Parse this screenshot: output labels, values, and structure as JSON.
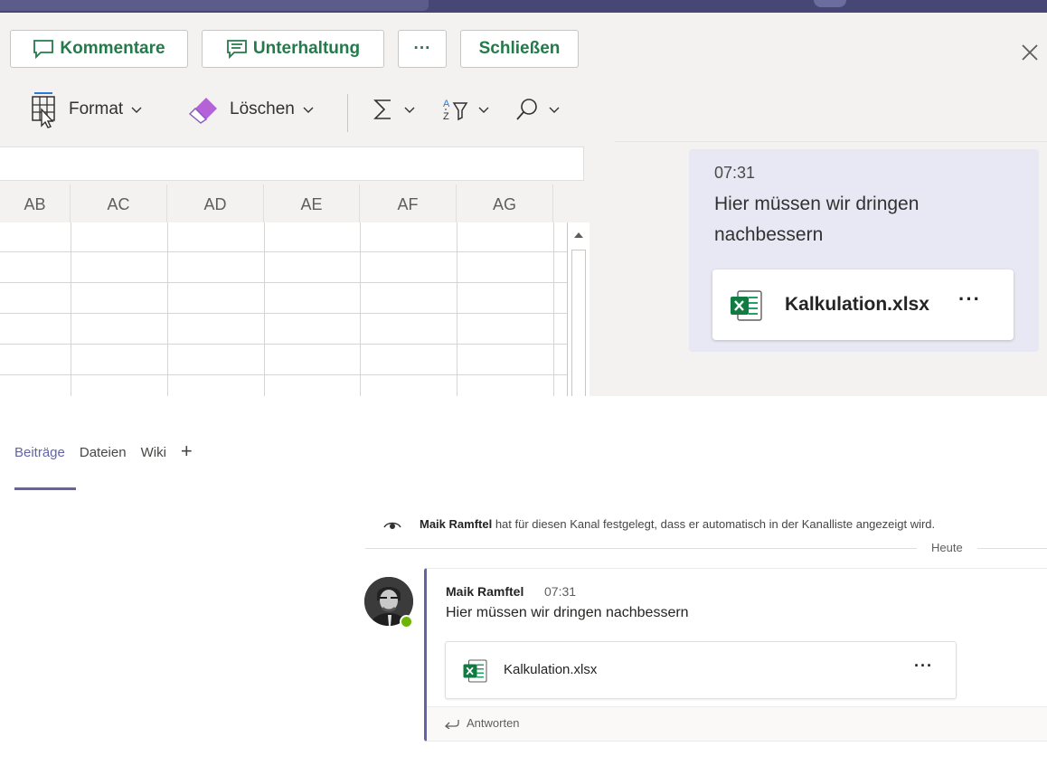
{
  "toolbar": {
    "comments_label": "Kommentare",
    "conversation_label": "Unterhaltung",
    "more_label": "···",
    "close_label": "Schließen"
  },
  "ribbon": {
    "format_label": "Format",
    "clear_label": "Löschen"
  },
  "grid": {
    "columns": [
      "AB",
      "AC",
      "AD",
      "AE",
      "AF",
      "AG"
    ]
  },
  "chat_pane": {
    "time": "07:31",
    "message": "Hier müssen wir dringen nachbessern",
    "file_name": "Kalkulation.xlsx",
    "file_more": "···"
  },
  "channel": {
    "tabs": [
      "Beiträge",
      "Dateien",
      "Wiki"
    ],
    "add_tab": "+",
    "system_author": "Maik Ramftel",
    "system_text": " hat für diesen Kanal festgelegt, dass er automatisch in der Kanalliste angezeigt wird.",
    "date_separator": "Heute",
    "post": {
      "author": "Maik Ramftel",
      "time": "07:31",
      "text": "Hier müssen wir dringen nachbessern",
      "file_name": "Kalkulation.xlsx",
      "file_more": "···",
      "reply_label": "Antworten"
    }
  },
  "colors": {
    "accent": "#6264a7",
    "excel_green": "#237b4b",
    "presence": "#6bb700"
  }
}
